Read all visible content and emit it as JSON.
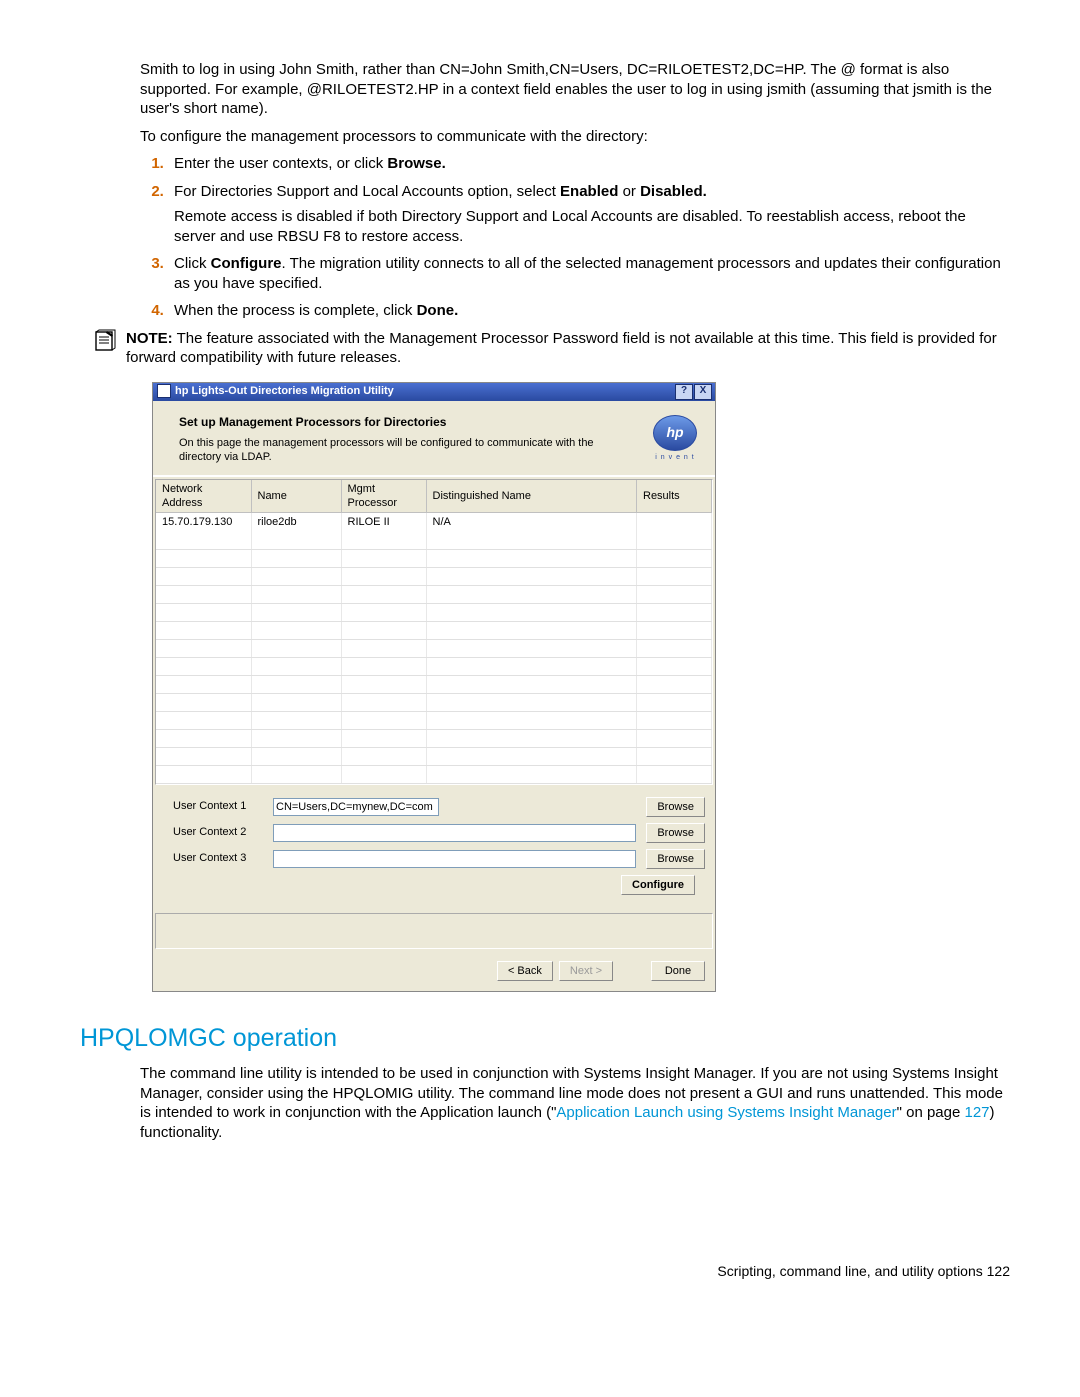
{
  "intro_paragraph": "Smith to log in using John Smith, rather than CN=John Smith,CN=Users, DC=RILOETEST2,DC=HP. The @ format is also supported. For example, @RILOETEST2.HP in a context field enables the user to log in using jsmith (assuming that jsmith is the user's short name).",
  "configure_intro": "To configure the management processors to communicate with the directory:",
  "steps": {
    "s1_pre": "Enter the user contexts, or click ",
    "s1_bold": "Browse.",
    "s2_pre": "For Directories Support and Local Accounts option, select ",
    "s2_b1": "Enabled",
    "s2_mid": " or ",
    "s2_b2": "Disabled.",
    "s2_sub": "Remote access is disabled if both Directory Support and Local Accounts are disabled. To reestablish access, reboot the server and use RBSU F8 to restore access.",
    "s3_pre": "Click ",
    "s3_bold": "Configure",
    "s3_post": ". The migration utility connects to all of the selected management processors and updates their configuration as you have specified.",
    "s4_pre": "When the process is complete, click ",
    "s4_bold": "Done."
  },
  "note": {
    "label": "NOTE:",
    "text": "  The feature associated with the Management Processor Password field is not available at this time. This field is provided for forward compatibility with future releases."
  },
  "window": {
    "title": "hp Lights-Out Directories Migration Utility",
    "help_btn": "?",
    "close_btn": "X",
    "heading": "Set up Management Processors for Directories",
    "subhead": "On this page the management processors will be configured to communicate with the directory via LDAP.",
    "logo": "hp",
    "logo_sub": "i n v e n t",
    "cols": {
      "c1": "Network Address",
      "c2": "Name",
      "c3": "Mgmt Processor",
      "c4": "Distinguished Name",
      "c5": "Results"
    },
    "row": {
      "addr": "15.70.179.130",
      "name": "riloe2db",
      "proc": "RILOE II",
      "dn": "N/A",
      "res": ""
    },
    "uc1_label": "User Context 1",
    "uc2_label": "User Context 2",
    "uc3_label": "User Context 3",
    "uc1_value": "CN=Users,DC=mynew,DC=com",
    "browse": "Browse",
    "configure": "Configure",
    "back": "< Back",
    "next": "Next >",
    "done": "Done"
  },
  "section_heading": "HPQLOMGC operation",
  "section_body_pre": "The command line utility is intended to be used in conjunction with Systems Insight Manager. If you are not using Systems Insight Manager, consider using the HPQLOMIG utility. The command line mode does not present a GUI and runs unattended. This mode is intended to work in conjunction with the Application launch (\"",
  "section_link": "Application Launch using Systems Insight Manager",
  "section_body_mid": "\" on page ",
  "section_page": "127",
  "section_body_post": ") functionality.",
  "footer": "Scripting, command line, and utility options   122"
}
